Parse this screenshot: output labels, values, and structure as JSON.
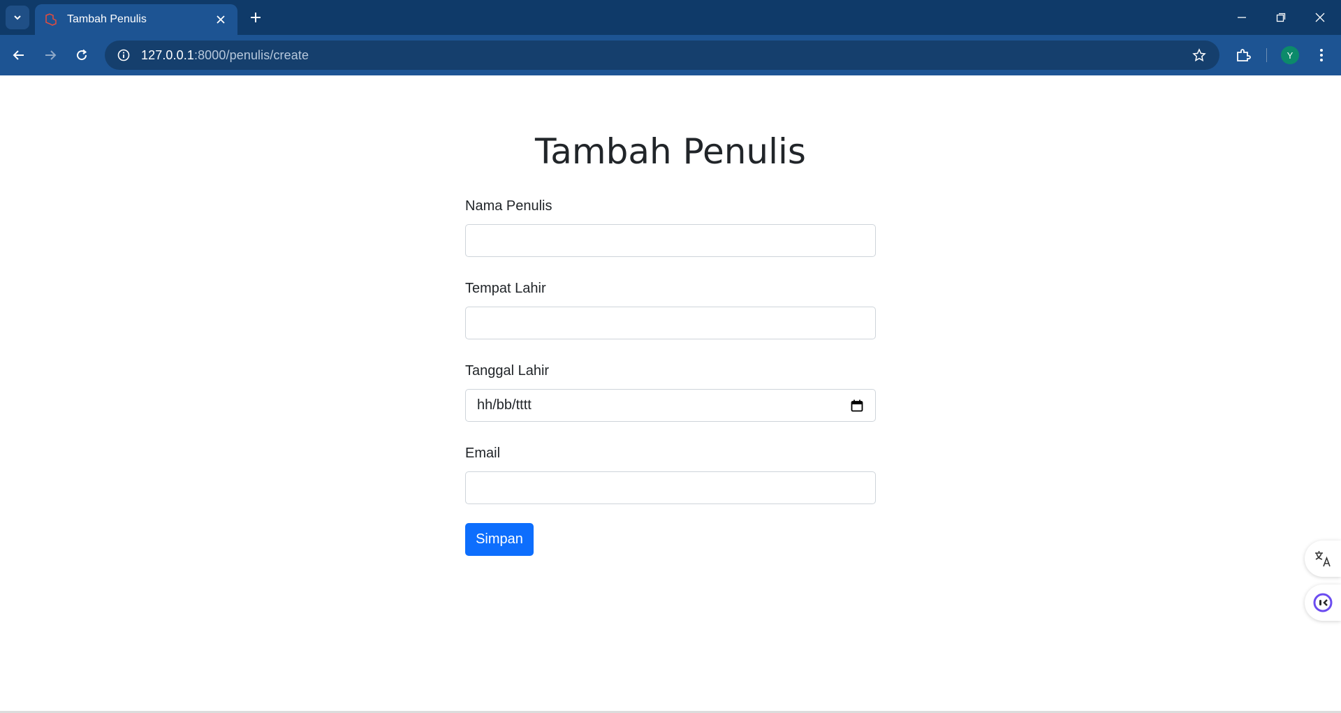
{
  "browser": {
    "tab_title": "Tambah Penulis",
    "url_host": "127.0.0.1",
    "url_rest": ":8000/penulis/create",
    "profile_initial": "Y"
  },
  "page": {
    "heading": "Tambah Penulis",
    "fields": [
      {
        "label": "Nama Penulis",
        "value": ""
      },
      {
        "label": "Tempat Lahir",
        "value": ""
      },
      {
        "label": "Tanggal Lahir",
        "placeholder": "hh/bb/tttt"
      },
      {
        "label": "Email",
        "value": ""
      }
    ],
    "submit_label": "Simpan"
  },
  "colors": {
    "tabbar": "#0f3a69",
    "toolbar": "#1d5493",
    "primary_button": "#0d6efd"
  }
}
